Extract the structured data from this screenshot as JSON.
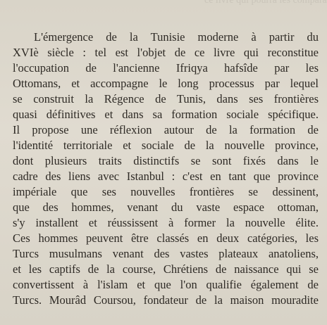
{
  "document": {
    "bleed_through": "ce livre qui pourra les comparaître dans l'ouvrage",
    "lines": [
      "L'émergence de la Tunisie moderne à partir du",
      "XVIè siècle : tel est l'objet de ce livre qui reconstitue",
      "l'occupation de l'ancienne Ifriqya hafsîde par les",
      "Ottomans, et accompagne le long processus par lequel",
      "se construit la Régence de Tunis, dans ses frontières",
      "quasi définitives et dans sa formation sociale spécifique.",
      "Il propose une réflexion autour de la formation de",
      "l'identité territoriale et sociale de la nouvelle province,",
      "dont plusieurs traits distinctifs se sont fixés dans le",
      "cadre des liens avec Istanbul : c'est en tant que province",
      "impériale que ses nouvelles frontières se dessinent,",
      "que des hommes, venant du vaste espace ottoman,",
      "s'y installent et réussissent à former la nouvelle élite.",
      "Ces hommes peuvent être classés en deux catégories, les",
      "Turcs musulmans venant des vastes plateaux anatoliens,",
      "et les captifs de la course, Chrétiens de naissance qui se",
      "convertissent à l'islam et que l'on qualifie également de",
      "Turcs. Mourâd Coursou, fondateur de la maison mouradite"
    ]
  }
}
